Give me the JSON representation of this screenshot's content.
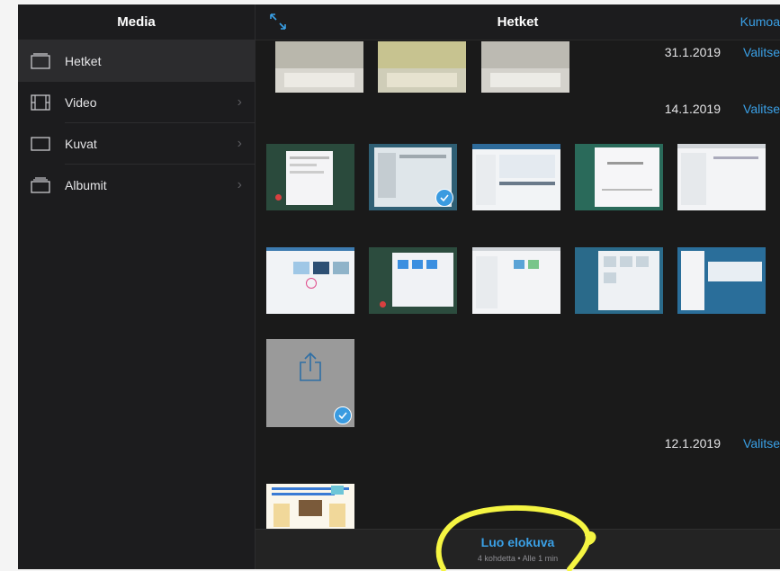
{
  "sidebar": {
    "title": "Media",
    "items": [
      {
        "label": "Hetket",
        "icon": "moments-icon",
        "active": true
      },
      {
        "label": "Video",
        "icon": "film-icon",
        "chevron": "›"
      },
      {
        "label": "Kuvat",
        "icon": "photo-icon",
        "chevron": "›"
      },
      {
        "label": "Albumit",
        "icon": "albums-icon",
        "chevron": "›"
      }
    ]
  },
  "topbar": {
    "title": "Hetket",
    "cancel_label": "Kumoa",
    "expand_icon": "expand-arrows-icon"
  },
  "sections": [
    {
      "date": "31.1.2019",
      "select_label": "Valitse"
    },
    {
      "date": "14.1.2019",
      "select_label": "Valitse"
    },
    {
      "date": "12.1.2019",
      "select_label": "Valitse"
    }
  ],
  "bottom": {
    "create_label": "Luo elokuva",
    "summary": "4 kohdetta • Alle 1 min"
  },
  "colors": {
    "accent": "#3aa0e6",
    "background": "#1c1c1e",
    "annotation": "#f5f542"
  }
}
